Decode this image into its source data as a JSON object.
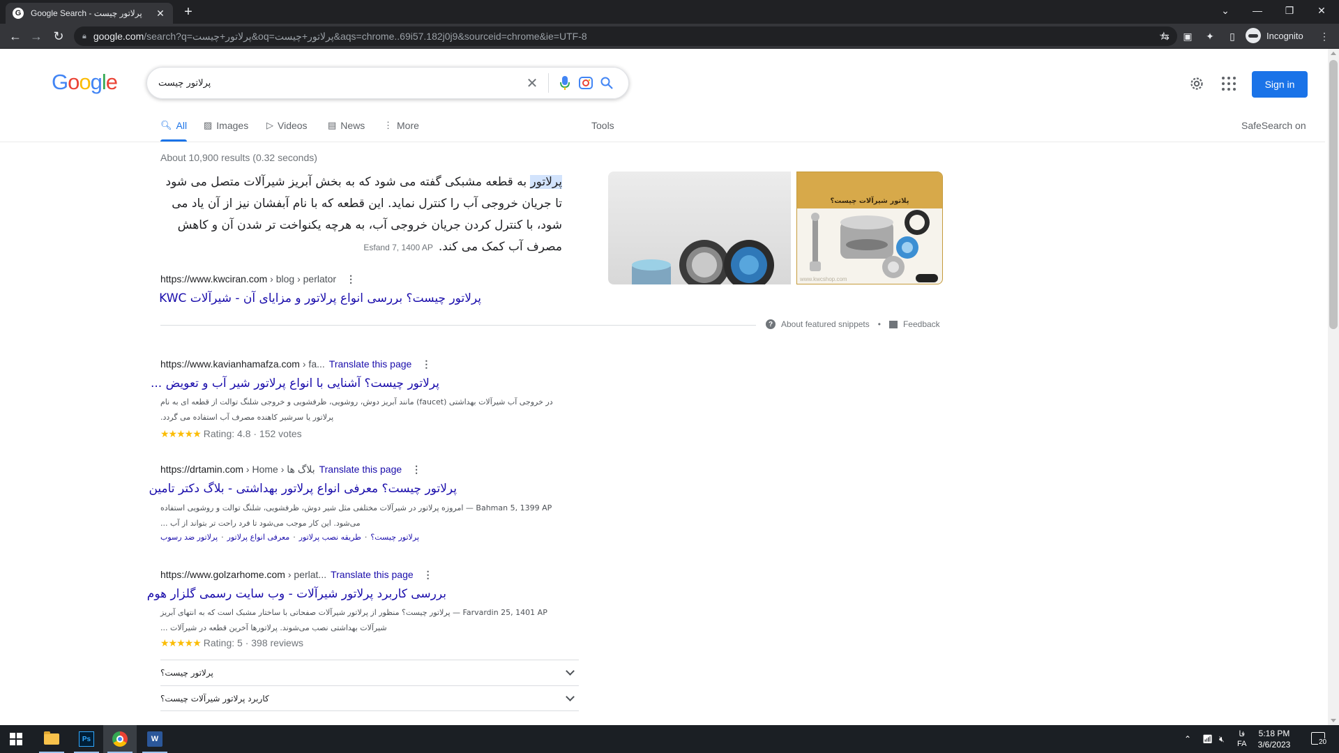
{
  "browser": {
    "tab_title": "Google Search - پرلاتور چیست",
    "url_host": "google.com",
    "url_rest": "/search?q=پرلاتور+چیست&oq=پرلاتور+چیست&aqs=chrome..69i57.182j0j9&sourceid=chrome&ie=UTF-8",
    "profile_label": "Incognito"
  },
  "google": {
    "logo": [
      "G",
      "o",
      "o",
      "g",
      "l",
      "e"
    ],
    "query": "پرلاتور چیست",
    "signin_label": "Sign in",
    "tabs": [
      {
        "label": "All",
        "icon": "search-icon"
      },
      {
        "label": "Images",
        "icon": "image-icon"
      },
      {
        "label": "Videos",
        "icon": "video-icon"
      },
      {
        "label": "News",
        "icon": "news-icon"
      },
      {
        "label": "More",
        "icon": "more-vert-icon"
      }
    ],
    "tools_label": "Tools",
    "safesearch_label": "SafeSearch on",
    "stats": "About 10,900 results (0.32 seconds)"
  },
  "featured": {
    "highlight": "پرلاتور",
    "text": " به قطعه مشبکی گفته می شود که به بخش آبریز شیرآلات متصل می شود تا جریان خروجی آب را کنترل نماید. این قطعه که با نام آبفشان نیز از آن یاد می شود، با کنترل کردن جریان خروجی آب، به هرچه یکنواخت تر شدن آن و کاهش مصرف آب کمک می کند.",
    "date": "Esfand 7, 1400 AP",
    "source_url": "https://www.kwciran.com",
    "source_path": " › blog › perlator",
    "source_title": "پرلاتور چیست؟ بررسی انواع پرلاتور و مزایای آن - شیرآلات KWC",
    "image_caption": "پلاتور شیرآلات چیست؟",
    "image_watermark": "www.kwcshop.com",
    "about_label": "About featured snippets",
    "bullet": "•",
    "feedback_label": "Feedback"
  },
  "results": [
    {
      "url": "https://www.kavianhamafza.com",
      "path": " › fa...",
      "translate": "Translate this page",
      "title": "پرلاتور چیست؟ آشنایی با انواع پرلاتور شیر آب و تعویض ...",
      "snippet_1": "در خروجی آب شیرآلات بهداشتی (faucet) مانند آبریز دوش، روشویی، ظرفشویی و خروجی شلنگ توالت از قطعه ای به نام",
      "snippet_2": "پرلاتور یا سرشیر کاهنده مصرف آب استفاده می گردد.",
      "stars": "★★★★★",
      "rating": "Rating: 4.8 · 152 votes"
    },
    {
      "url": "https://drtamin.com",
      "path": " › Home › بلاگ ها",
      "translate": "Translate this page",
      "title": "پرلاتور چیست؟ معرفی انواع پرلاتور بهداشتی - بلاگ دکتر تامین",
      "snippet_1": "Bahman 5, 1399 AP — امروزه پرلاتور در شیرآلات مختلفی مثل شیر دوش، ظرفشویی، شلنگ توالت و روشویی استفاده",
      "snippet_2": "می‌شود. این کار موجب می‌شود تا فرد راحت تر بتواند از آب ...",
      "sublinks": [
        "پرلاتور چیست؟",
        "طریقه نصب پرلاتور",
        "معرفی انواع پرلاتور",
        "پرلاتور ضد رسوب"
      ]
    },
    {
      "url": "https://www.golzarhome.com",
      "path": " › perlat...",
      "translate": "Translate this page",
      "title": "بررسی کاربرد پرلاتور شیرآلات - وب سایت رسمی گلزار هوم",
      "snippet_1": "Farvardin 25, 1401 AP — پرلاتور چیست؟ منظور از پرلاتور شیرآلات صفحاتی با ساختار مشبک است که به انتهای آبریز",
      "snippet_2": "شیرآلات بهداشتی نصب می‌شوند. پرلاتورها آخرین قطعه در شیرآلات ...",
      "stars": "★★★★★",
      "rating": "Rating: 5 · 398 reviews"
    }
  ],
  "faq": [
    "پرلاتور چیست؟",
    "کاربرد پرلاتور شیرآلات چیست؟"
  ],
  "taskbar": {
    "lang_1": "فا",
    "lang_2": "FA",
    "time": "5:18 PM",
    "date": "3/6/2023",
    "notif_count": "20",
    "ps_label": "Ps",
    "word_label": "W"
  },
  "colors": {
    "accent": "#1a73e8",
    "link": "#1a0dab",
    "chrome_dark": "#202124"
  }
}
